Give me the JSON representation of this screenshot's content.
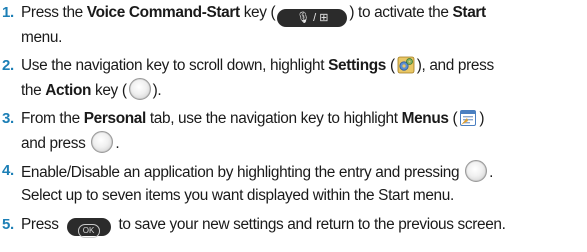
{
  "steps": [
    {
      "number": "1.",
      "a": "Press the ",
      "b1": "Voice Command-Start",
      "c": " key (",
      "key_label": "🎙 / ⊞",
      "d": ") to activate the ",
      "b2": "Start",
      "e": "menu."
    },
    {
      "number": "2.",
      "a": "Use the navigation key to scroll down, highlight ",
      "b1": "Settings",
      "c": " (",
      "d": "), and press",
      "e1": "the ",
      "b2": "Action",
      "f": " key (",
      "g": ")."
    },
    {
      "number": "3.",
      "a": "From the ",
      "b1": "Personal",
      "c": " tab, use the navigation key to highlight ",
      "b2": "Menus",
      "d": " (",
      "e": ")",
      "f": "and press ",
      "g": "."
    },
    {
      "number": "4.",
      "a": "Enable/Disable an application by highlighting the entry and pressing ",
      "b": ".",
      "line2": "Select up to seven items you want displayed within the Start menu."
    },
    {
      "number": "5.",
      "a": "Press ",
      "ok_label": "OK",
      "b": " to save your new settings and return to the previous screen."
    }
  ],
  "colors": {
    "step_number": "#1c7fb6",
    "text": "#1a1a1a"
  }
}
